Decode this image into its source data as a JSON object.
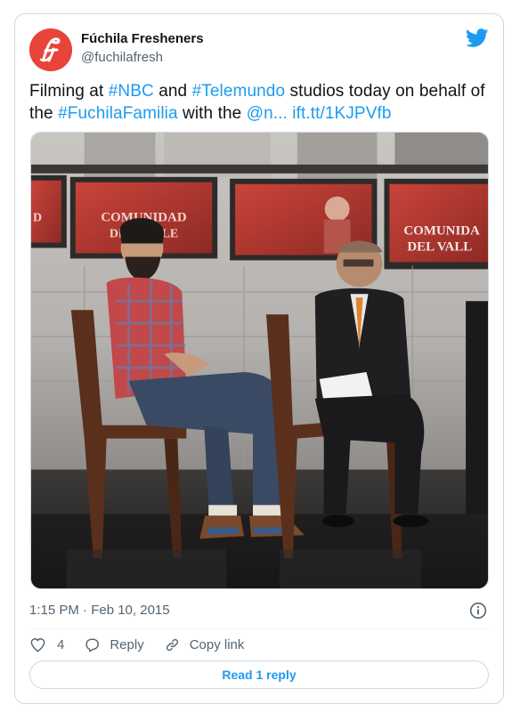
{
  "author": {
    "display_name": "Fúchila Fresheners",
    "handle": "@fuchilafresh",
    "avatar_icon": "fuchila-logo-icon",
    "avatar_color": "#e8443b"
  },
  "tweet": {
    "segments": [
      {
        "type": "text",
        "text": "Filming at "
      },
      {
        "type": "link",
        "text": "#NBC"
      },
      {
        "type": "text",
        "text": " and "
      },
      {
        "type": "link",
        "text": "#Telemundo"
      },
      {
        "type": "text",
        "text": " studios today on behalf of the "
      },
      {
        "type": "link",
        "text": "#FuchilaFamilia"
      },
      {
        "type": "text",
        "text": " with  the "
      },
      {
        "type": "link",
        "text": "@n..."
      },
      {
        "type": "text",
        "text": " "
      },
      {
        "type": "link",
        "text": "ift.tt/1KJPVfb"
      }
    ]
  },
  "media": {
    "screen_left_line1": "D",
    "screen_left_line2": "",
    "screen_center_line1": "COMUNIDAD",
    "screen_center_line2": "DEL VALLE",
    "screen_right_line1": "COMUNIDA",
    "screen_right_line2": "DEL VALL"
  },
  "meta": {
    "timestamp": "1:15 PM · Feb 10, 2015",
    "info_icon": "info-icon"
  },
  "actions": {
    "like_count": "4",
    "reply_label": "Reply",
    "copy_label": "Copy link"
  },
  "read_replies_label": "Read 1 reply",
  "colors": {
    "link": "#1d9bf0",
    "secondary_text": "#536471",
    "border": "#cfd9de",
    "twitter_blue": "#1d9bf0"
  }
}
